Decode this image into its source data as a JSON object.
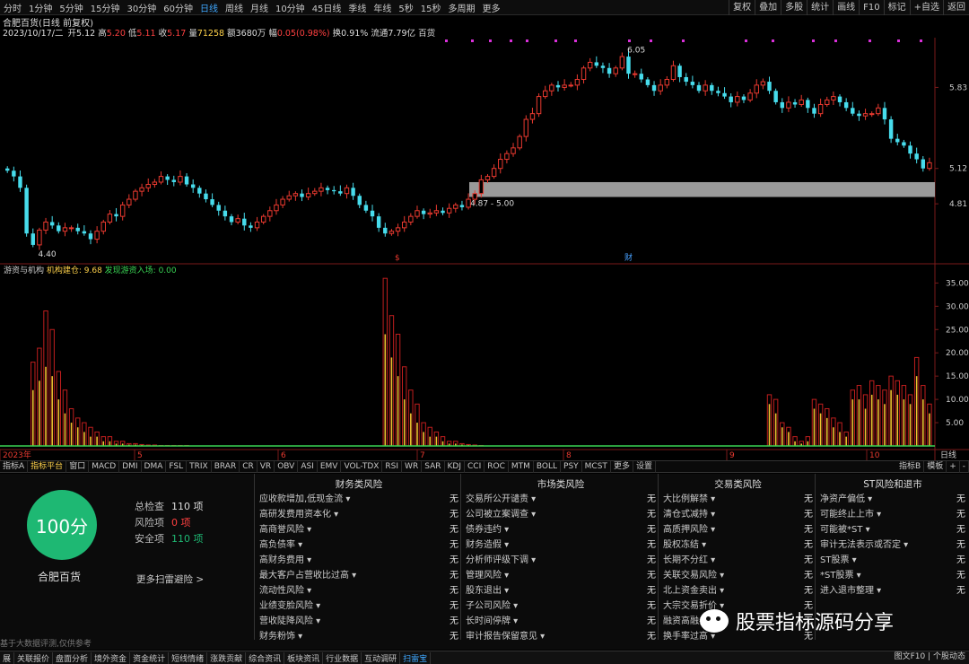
{
  "toolbar": {
    "periods": [
      "分时",
      "1分钟",
      "5分钟",
      "15分钟",
      "30分钟",
      "60分钟",
      "日线",
      "周线",
      "月线",
      "10分钟",
      "45日线",
      "季线",
      "年线",
      "5秒",
      "15秒",
      "多周期",
      "更多"
    ],
    "active_period": "日线",
    "right_items": [
      "复权",
      "叠加",
      "多股",
      "统计",
      "画线",
      "F10",
      "标记",
      "+自选",
      "返回"
    ]
  },
  "info": {
    "title": "合肥百货(日线 前复权)",
    "date": "2023/10/17/二",
    "open_label": "开",
    "open": "5.12",
    "high_label": "高",
    "high": "5.20",
    "low_label": "低",
    "low": "5.11",
    "close_label": "收",
    "close": "5.17",
    "volume_label": "量",
    "volume": "71258",
    "amount_label": "额",
    "amount": "3680万",
    "change_label": "幅",
    "change": "0.05(0.98%)",
    "turnover_label": "换",
    "turnover": "0.91%",
    "float_label": "流通",
    "float": "7.79亿",
    "tag": "百货"
  },
  "main_chart": {
    "price_axis": [
      "5.83",
      "5.12",
      "4.81"
    ],
    "ylim": [
      4.3,
      6.25
    ],
    "high_label": "6.05",
    "low_label": "4.40",
    "zone_label": "4.87 - 5.00",
    "zone": [
      4.87,
      5.0
    ],
    "marker_s": "$",
    "marker_cai": "财",
    "colors": {
      "up": "#e8392f",
      "down": "#47dcec",
      "zone": "#9a9a9a",
      "marks": "#d930d9"
    }
  },
  "sub_chart": {
    "title": "游资与机构",
    "series1_label": "机构建仓:",
    "series1_value": "9.68",
    "series2_label": "发现游资入场:",
    "series2_value": "0.00",
    "axis": [
      "35.00",
      "30.00",
      "25.00",
      "20.00",
      "15.00",
      "10.00",
      "5.00"
    ],
    "ylim": [
      0,
      37
    ]
  },
  "chart_data": {
    "type": "bar",
    "title": "",
    "x_labels": [
      "2023年",
      "5",
      "6",
      "7",
      "8",
      "9",
      "10"
    ],
    "candles": {
      "open": [
        5.12,
        5.1,
        5.05,
        4.95,
        4.55,
        4.45,
        4.58,
        4.65,
        4.62,
        4.57,
        4.6,
        4.6,
        4.57,
        4.55,
        4.5,
        4.57,
        4.65,
        4.72,
        4.7,
        4.8,
        4.85,
        4.92,
        4.95,
        4.98,
        5.0,
        5.05,
        5.02,
        5.0,
        5.05,
        4.98,
        4.95,
        4.9,
        4.85,
        4.8,
        4.75,
        4.7,
        4.65,
        4.68,
        4.62,
        4.6,
        4.65,
        4.7,
        4.75,
        4.8,
        4.85,
        4.88,
        4.9,
        4.87,
        4.9,
        4.92,
        4.95,
        4.93,
        4.92,
        4.9,
        4.95,
        4.88,
        4.8,
        4.75,
        4.7,
        4.6,
        4.55,
        4.57,
        4.6,
        4.65,
        4.7,
        4.75,
        4.72,
        4.73,
        4.75,
        4.73,
        4.77,
        4.8,
        4.78,
        4.85,
        4.9,
        5.02,
        5.05,
        5.12,
        5.2,
        5.25,
        5.3,
        5.4,
        5.55,
        5.6,
        5.75,
        5.8,
        5.85,
        5.83,
        5.85,
        5.85,
        5.9,
        6.0,
        6.05,
        6.02,
        6.0,
        5.95,
        6.0,
        6.1,
        5.95,
        5.95,
        5.9,
        5.85,
        5.8,
        5.85,
        5.9,
        6.02,
        5.92,
        5.88,
        5.85,
        5.8,
        5.85,
        5.8,
        5.78,
        5.75,
        5.7,
        5.75,
        5.72,
        5.78,
        5.85,
        5.88,
        5.8,
        5.7,
        5.65,
        5.7,
        5.68,
        5.72,
        5.65,
        5.6,
        5.68,
        5.72,
        5.75,
        5.7,
        5.65,
        5.6,
        5.58,
        5.6,
        5.6,
        5.65,
        5.55,
        5.38,
        5.35,
        5.32,
        5.25,
        5.2,
        5.12
      ],
      "close": [
        5.1,
        5.05,
        4.95,
        4.55,
        4.45,
        4.58,
        4.65,
        4.62,
        4.57,
        4.6,
        4.6,
        4.57,
        4.55,
        4.5,
        4.57,
        4.65,
        4.72,
        4.7,
        4.8,
        4.85,
        4.92,
        4.95,
        4.98,
        5.0,
        5.05,
        5.02,
        5.0,
        5.05,
        4.98,
        4.95,
        4.9,
        4.85,
        4.8,
        4.75,
        4.7,
        4.65,
        4.68,
        4.62,
        4.6,
        4.65,
        4.7,
        4.75,
        4.8,
        4.85,
        4.88,
        4.9,
        4.87,
        4.9,
        4.92,
        4.95,
        4.93,
        4.92,
        4.9,
        4.95,
        4.88,
        4.8,
        4.75,
        4.7,
        4.6,
        4.55,
        4.57,
        4.6,
        4.65,
        4.7,
        4.75,
        4.72,
        4.73,
        4.75,
        4.73,
        4.77,
        4.8,
        4.78,
        4.85,
        4.9,
        5.02,
        5.05,
        5.12,
        5.2,
        5.25,
        5.3,
        5.4,
        5.55,
        5.6,
        5.75,
        5.8,
        5.85,
        5.83,
        5.85,
        5.85,
        5.9,
        6.0,
        6.05,
        6.02,
        6.0,
        5.95,
        6.0,
        6.1,
        5.95,
        5.95,
        5.9,
        5.85,
        5.8,
        5.85,
        5.9,
        6.02,
        5.92,
        5.88,
        5.85,
        5.8,
        5.85,
        5.8,
        5.78,
        5.75,
        5.7,
        5.75,
        5.72,
        5.78,
        5.85,
        5.88,
        5.8,
        5.7,
        5.65,
        5.7,
        5.68,
        5.72,
        5.65,
        5.6,
        5.68,
        5.72,
        5.75,
        5.7,
        5.65,
        5.6,
        5.58,
        5.6,
        5.6,
        5.65,
        5.55,
        5.38,
        5.35,
        5.32,
        5.25,
        5.2,
        5.12,
        5.17
      ]
    },
    "series": [
      {
        "name": "机构建仓",
        "values": [
          0,
          0,
          0,
          0,
          18,
          21,
          29,
          25,
          16,
          12,
          8,
          6,
          5,
          4,
          3,
          2,
          2,
          1,
          1,
          0.5,
          0.5,
          0.3,
          0.2,
          0.2,
          0.1,
          0.1,
          0.1,
          0.1,
          0.1,
          0,
          0,
          0,
          0,
          0,
          0,
          0,
          0,
          0,
          0,
          0,
          0,
          0,
          0,
          0,
          0,
          0,
          0,
          0,
          0,
          0,
          0,
          0,
          0,
          0,
          0,
          0,
          0,
          0,
          0,
          36,
          28,
          24,
          17,
          12,
          9,
          5,
          4,
          3,
          2,
          1,
          1,
          0.5,
          0.3,
          0.2,
          0.1,
          0,
          0,
          0,
          0,
          0,
          0,
          0,
          0,
          0,
          0,
          0,
          0,
          0,
          0,
          0,
          0,
          0,
          0,
          0,
          0,
          0,
          0,
          0,
          0,
          0,
          0,
          0,
          0,
          0,
          0,
          0,
          0,
          0,
          0,
          0,
          0,
          0,
          0,
          0,
          0,
          0,
          0,
          0,
          0,
          11,
          10,
          5,
          4,
          2,
          1,
          2,
          10,
          9,
          8,
          6,
          5,
          3,
          12,
          13,
          11,
          14,
          13,
          12,
          15,
          14,
          13,
          11,
          19,
          13,
          9
        ]
      },
      {
        "name": "发现游资入场",
        "values": [
          0,
          0,
          0,
          0,
          12,
          14,
          17,
          15,
          10,
          7,
          5,
          4,
          3,
          2,
          2,
          1,
          1,
          0.5,
          0.5,
          0.3,
          0.3,
          0.2,
          0.1,
          0.1,
          0,
          0,
          0,
          0,
          0,
          0,
          0,
          0,
          0,
          0,
          0,
          0,
          0,
          0,
          0,
          0,
          0,
          0,
          0,
          0,
          0,
          0,
          0,
          0,
          0,
          0,
          0,
          0,
          0,
          0,
          0,
          0,
          0,
          0,
          0,
          24,
          19,
          15,
          10,
          7,
          5,
          3,
          2,
          2,
          1,
          0.5,
          0.5,
          0.3,
          0.2,
          0.1,
          0,
          0,
          0,
          0,
          0,
          0,
          0,
          0,
          0,
          0,
          0,
          0,
          0,
          0,
          0,
          0,
          0,
          0,
          0,
          0,
          0,
          0,
          0,
          0,
          0,
          0,
          0,
          0,
          0,
          0,
          0,
          0,
          0,
          0,
          0,
          0,
          0,
          0,
          0,
          0,
          0,
          0,
          0,
          0,
          0,
          9,
          7,
          4,
          3,
          1,
          0.5,
          1,
          8,
          7,
          6,
          4,
          3,
          2,
          10,
          10,
          8,
          11,
          10,
          9,
          12,
          11,
          10,
          9,
          15,
          10,
          7
        ]
      }
    ]
  },
  "indicator_tabs": [
    "指标A",
    "指标平台",
    "窗口",
    "MACD",
    "DMI",
    "DMA",
    "FSL",
    "TRIX",
    "BRAR",
    "CR",
    "VR",
    "OBV",
    "ASI",
    "EMV",
    "VOL-TDX",
    "RSI",
    "WR",
    "SAR",
    "KDJ",
    "CCI",
    "ROC",
    "MTM",
    "BOLL",
    "PSY",
    "MCST",
    "更多",
    "设置"
  ],
  "indicator_right": [
    "指标B",
    "模板",
    "+",
    "-"
  ],
  "panel": {
    "score": "100分",
    "stock": "合肥百货",
    "total_label": "总检查",
    "total": "110 项",
    "risk_label": "风险项",
    "risk": "0 项",
    "safe_label": "安全项",
    "safe": "110 项",
    "more": "更多扫雷避险 >",
    "disclaimer": "基于大数据评测,仅供参考",
    "columns": [
      {
        "title": "财务类风险",
        "rows": [
          [
            "应收款增加,低现金流",
            "无"
          ],
          [
            "高研发费用资本化",
            "无"
          ],
          [
            "高商誉风险",
            "无"
          ],
          [
            "高负债率",
            "无"
          ],
          [
            "高财务费用",
            "无"
          ],
          [
            "最大客户占营收比过高",
            "无"
          ],
          [
            "流动性风险",
            "无"
          ],
          [
            "业绩变脸风险",
            "无"
          ],
          [
            "营收陡降风险",
            "无"
          ],
          [
            "财务粉饰",
            "无"
          ]
        ]
      },
      {
        "title": "市场类风险",
        "rows": [
          [
            "交易所公开谴责",
            "无"
          ],
          [
            "公司被立案调查",
            "无"
          ],
          [
            "债券违约",
            "无"
          ],
          [
            "财务造假",
            "无"
          ],
          [
            "分析师评级下调",
            "无"
          ],
          [
            "管理风险",
            "无"
          ],
          [
            "股东退出",
            "无"
          ],
          [
            "子公司风险",
            "无"
          ],
          [
            "长时间停牌",
            "无"
          ],
          [
            "审计报告保留意见",
            "无"
          ]
        ]
      },
      {
        "title": "交易类风险",
        "rows": [
          [
            "大比例解禁",
            "无"
          ],
          [
            "清仓式减持",
            "无"
          ],
          [
            "高质押风险",
            "无"
          ],
          [
            "股权冻结",
            "无"
          ],
          [
            "长期不分红",
            "无"
          ],
          [
            "关联交易风险",
            "无"
          ],
          [
            "北上资金卖出",
            "无"
          ],
          [
            "大宗交易折价",
            "无"
          ],
          [
            "融资高融券",
            "无"
          ],
          [
            "换手率过高",
            "无"
          ]
        ]
      },
      {
        "title": "ST风险和退市",
        "rows": [
          [
            "净资产偏低",
            "无"
          ],
          [
            "可能终止上市",
            "无"
          ],
          [
            "可能被*ST",
            "无"
          ],
          [
            "审计无法表示或否定",
            "无"
          ],
          [
            "ST股票",
            "无"
          ],
          [
            "*ST股票",
            "无"
          ],
          [
            "进入退市整理",
            "无"
          ]
        ]
      }
    ]
  },
  "bottom": {
    "tabs": [
      "展",
      "关联报价",
      "盘面分析",
      "境外资金",
      "资金统计",
      "短线情绪",
      "涨跌贡献",
      "综合资讯",
      "板块资讯",
      "行业数据",
      "互动调研",
      "扫雷宝"
    ],
    "active": "扫雷宝",
    "right": "图文F10 | 个股动态"
  },
  "watermark": "股票指标源码分享",
  "watermark_icon": "wechat-icon"
}
